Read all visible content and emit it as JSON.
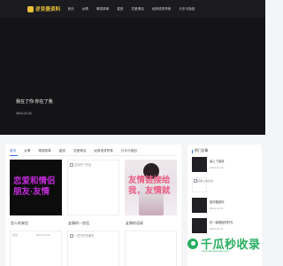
{
  "header": {
    "logo_text": "逆变器资料",
    "nav": [
      "首页",
      "女情",
      "情感故事",
      "星座",
      "恋爱情话",
      "经典语录赞美",
      "分手与挽回"
    ]
  },
  "hero": {
    "title": "我在了你·你在了我",
    "date": "2024-12-31"
  },
  "tabs": [
    "首页",
    "女情",
    "情感故事",
    "星座",
    "恋爱情话",
    "经典语录赞美",
    "分手与挽回"
  ],
  "cards": [
    {
      "title": "恋人的来信",
      "overlay": [
        "恋爱和情侣",
        "朋友·友情"
      ]
    },
    {
      "title": "友情的一些话",
      "broken_text": "友情的一些话"
    },
    {
      "title": "友情的语录",
      "overlay": [
        "友情链接给",
        "我，友情就"
      ]
    }
  ],
  "row2": [
    {
      "meta_left": "标签",
      "meta_right": "2024-12-31",
      "broken_text": "",
      "dark": false
    },
    {
      "broken_text": "一些子的恋爱情",
      "meta_right": "",
      "dark": false
    },
    {
      "meta_left": "",
      "meta_right": "",
      "dark": true
    }
  ],
  "sidebar": {
    "title": "热门文章",
    "items": [
      {
        "title": "喜上了喜欢",
        "date": "2024-12-31",
        "light": false,
        "broken": ""
      },
      {
        "title": "",
        "date": "",
        "light": true,
        "broken": "经典心情说说"
      },
      {
        "title": "如何挽回你",
        "date": "2024-12-31",
        "light": false,
        "broken": ""
      },
      {
        "title": "在一起相处的时光",
        "date": "2024-12-31",
        "light": false,
        "broken": ""
      }
    ]
  },
  "watermark": {
    "text": "千瓜秒收录",
    "sub": "www.qianguamiao.com"
  },
  "colors": {
    "accent": "#3a6fd8",
    "logo": "#e9c23a",
    "watermark": "#27ae60",
    "overlay_magenta": "#c02bd8",
    "overlay_pink": "#ea5e86"
  }
}
